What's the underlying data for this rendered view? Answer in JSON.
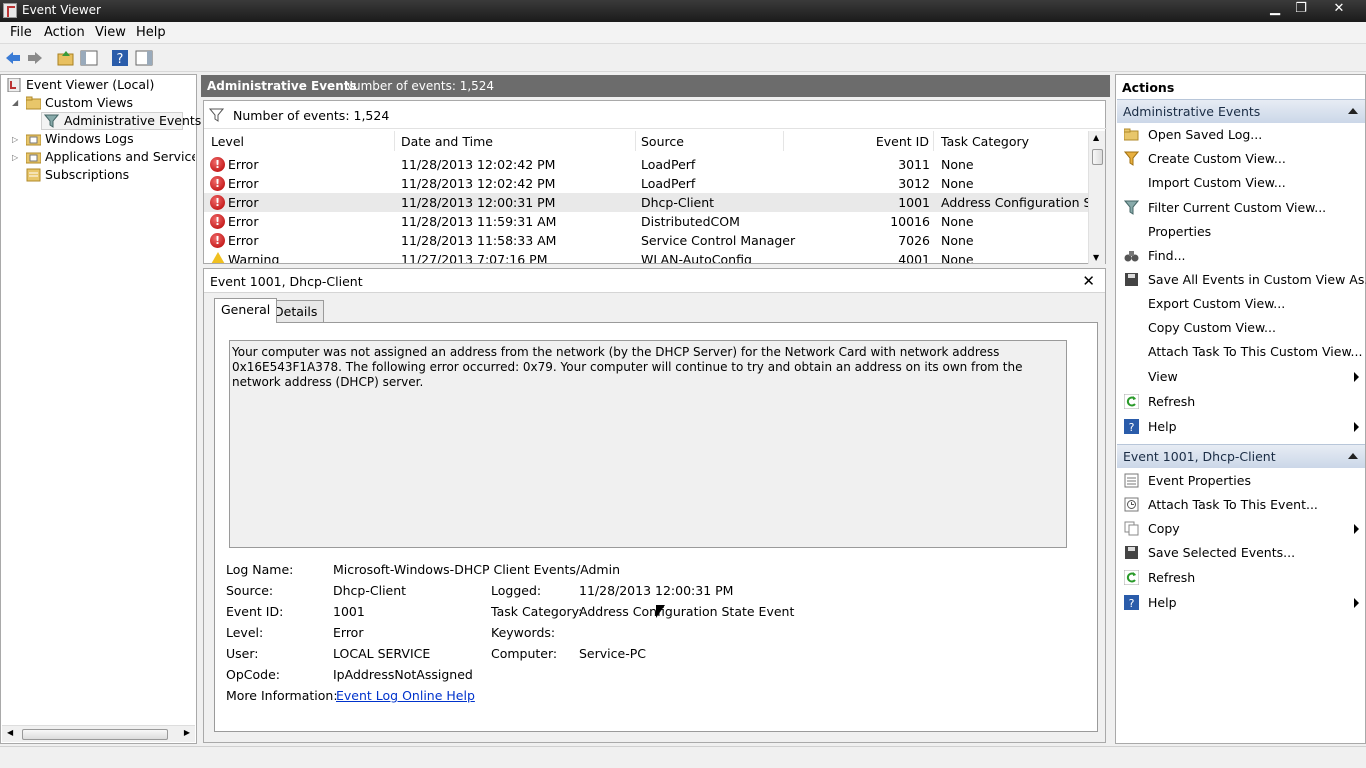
{
  "window": {
    "title": "Event Viewer",
    "min": "▁",
    "max": "❐",
    "close": "✕"
  },
  "menu": [
    "File",
    "Action",
    "View",
    "Help"
  ],
  "tree": {
    "root": "Event Viewer (Local)",
    "custom_views": "Custom Views",
    "admin_events": "Administrative Events",
    "windows_logs": "Windows Logs",
    "apps_services": "Applications and Services Lo",
    "subscriptions": "Subscriptions"
  },
  "center": {
    "title": "Administrative Events",
    "count": "Number of events: 1,524",
    "filter_text": "Number of events: 1,524",
    "columns": [
      "Level",
      "Date and Time",
      "Source",
      "Event ID",
      "Task Category"
    ],
    "rows": [
      {
        "level": "Error",
        "date": "11/28/2013 12:02:42 PM",
        "source": "LoadPerf",
        "id": "3011",
        "cat": "None"
      },
      {
        "level": "Error",
        "date": "11/28/2013 12:02:42 PM",
        "source": "LoadPerf",
        "id": "3012",
        "cat": "None"
      },
      {
        "level": "Error",
        "date": "11/28/2013 12:00:31 PM",
        "source": "Dhcp-Client",
        "id": "1001",
        "cat": "Address Configuration S..."
      },
      {
        "level": "Error",
        "date": "11/28/2013 11:59:31 AM",
        "source": "DistributedCOM",
        "id": "10016",
        "cat": "None"
      },
      {
        "level": "Error",
        "date": "11/28/2013 11:58:33 AM",
        "source": "Service Control Manager",
        "id": "7026",
        "cat": "None"
      },
      {
        "level": "Warning",
        "date": "11/27/2013 7:07:16 PM",
        "source": "WLAN-AutoConfig",
        "id": "4001",
        "cat": "None"
      }
    ]
  },
  "detail": {
    "title": "Event 1001, Dhcp-Client",
    "tabs": [
      "General",
      "Details"
    ],
    "description": "Your computer was not assigned an address from the network (by the DHCP Server) for the Network Card with network address 0x16E543F1A378.  The following error occurred: 0x79. Your computer will continue to try and obtain an address on its own from the network address (DHCP) server.",
    "log_name_label": "Log Name:",
    "log_name": "Microsoft-Windows-DHCP Client Events/Admin",
    "source_label": "Source:",
    "source": "Dhcp-Client",
    "logged_label": "Logged:",
    "logged": "11/28/2013 12:00:31 PM",
    "event_id_label": "Event ID:",
    "event_id": "1001",
    "task_cat_label": "Task Category:",
    "task_cat": "Address Configuration State Event",
    "level_label": "Level:",
    "level": "Error",
    "keywords_label": "Keywords:",
    "keywords": "",
    "user_label": "User:",
    "user": "LOCAL SERVICE",
    "computer_label": "Computer:",
    "computer": "Service-PC",
    "opcode_label": "OpCode:",
    "opcode": "IpAddressNotAssigned",
    "more_info_label": "More Information:",
    "more_info": "Event Log Online Help"
  },
  "actions": {
    "header": "Actions",
    "section1": "Administrative Events",
    "items1": [
      "Open Saved Log...",
      "Create Custom View...",
      "Import Custom View...",
      "Filter Current Custom View...",
      "Properties",
      "Find...",
      "Save All Events in Custom View As...",
      "Export Custom View...",
      "Copy Custom View...",
      "Attach Task To This Custom View...",
      "View",
      "Refresh",
      "Help"
    ],
    "section2": "Event 1001, Dhcp-Client",
    "items2": [
      "Event Properties",
      "Attach Task To This Event...",
      "Copy",
      "Save Selected Events...",
      "Refresh",
      "Help"
    ]
  }
}
